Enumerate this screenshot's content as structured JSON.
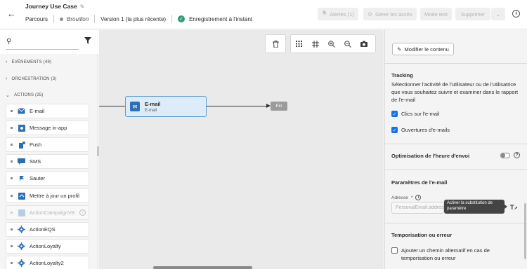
{
  "header": {
    "journey_title": "Journey Use Case",
    "breadcrumb": "Parcours",
    "status": "Brouillon",
    "version": "Version 1 (la plus récente)",
    "saved": "Enregistrement à l'instant",
    "buttons": {
      "alerts": "Alertes (1)",
      "access": "Gérer les accès",
      "test_mode": "Mode test",
      "delete": "Supprimer"
    }
  },
  "left_panel": {
    "categories": {
      "events": "ÉVÉNEMENTS (49)",
      "orchestration": "ORCHESTRATION (3)",
      "actions": "ACTIONS (25)"
    },
    "actions": [
      {
        "label": "E-mail",
        "icon": "email-icon"
      },
      {
        "label": "Message in-app",
        "icon": "inapp-message-icon"
      },
      {
        "label": "Push",
        "icon": "push-icon"
      },
      {
        "label": "SMS",
        "icon": "sms-icon"
      },
      {
        "label": "Sauter",
        "icon": "jump-icon"
      },
      {
        "label": "Mettre à jour un profil",
        "icon": "update-profile-icon"
      },
      {
        "label": "ActionCampaignV8",
        "icon": "campaign-icon",
        "disabled": true
      },
      {
        "label": "ActionEQS",
        "icon": "custom-action-icon"
      },
      {
        "label": "ActionLoyalty",
        "icon": "custom-action-icon"
      },
      {
        "label": "ActionLoyalty2",
        "icon": "custom-action-icon"
      }
    ]
  },
  "canvas": {
    "node": {
      "title": "E-mail",
      "subtitle": "E-mail"
    },
    "end_label": "Fin"
  },
  "right_panel": {
    "modify_button": "Modifier le contenu",
    "tracking": {
      "title": "Tracking",
      "description": "Sélectionner l'activité de l'utilisateur ou de l'utilisatrice que vous souhaitez suivre et examiner dans le rapport de l'e-mail",
      "option1": "Clics sur l'e-mail",
      "option2": "Ouvertures d'e-mails"
    },
    "send_time": {
      "title": "Optimisation de l'heure d'envoi"
    },
    "email_params": {
      "title": "Paramètres de l'e-mail",
      "address_label": "Adresse",
      "required_mark": "*",
      "address_value": "PersonalEmail.address",
      "tooltip": "Activer la substitution de paramètre"
    },
    "timeout": {
      "title": "Temporisation ou erreur",
      "option": "Ajouter un chemin alternatif en cas de temporisation ou erreur"
    }
  },
  "colors": {
    "accent": "#1473e6",
    "success": "#2d9d78",
    "node_bg": "#deecf9",
    "node_border": "#5a9bd6"
  }
}
